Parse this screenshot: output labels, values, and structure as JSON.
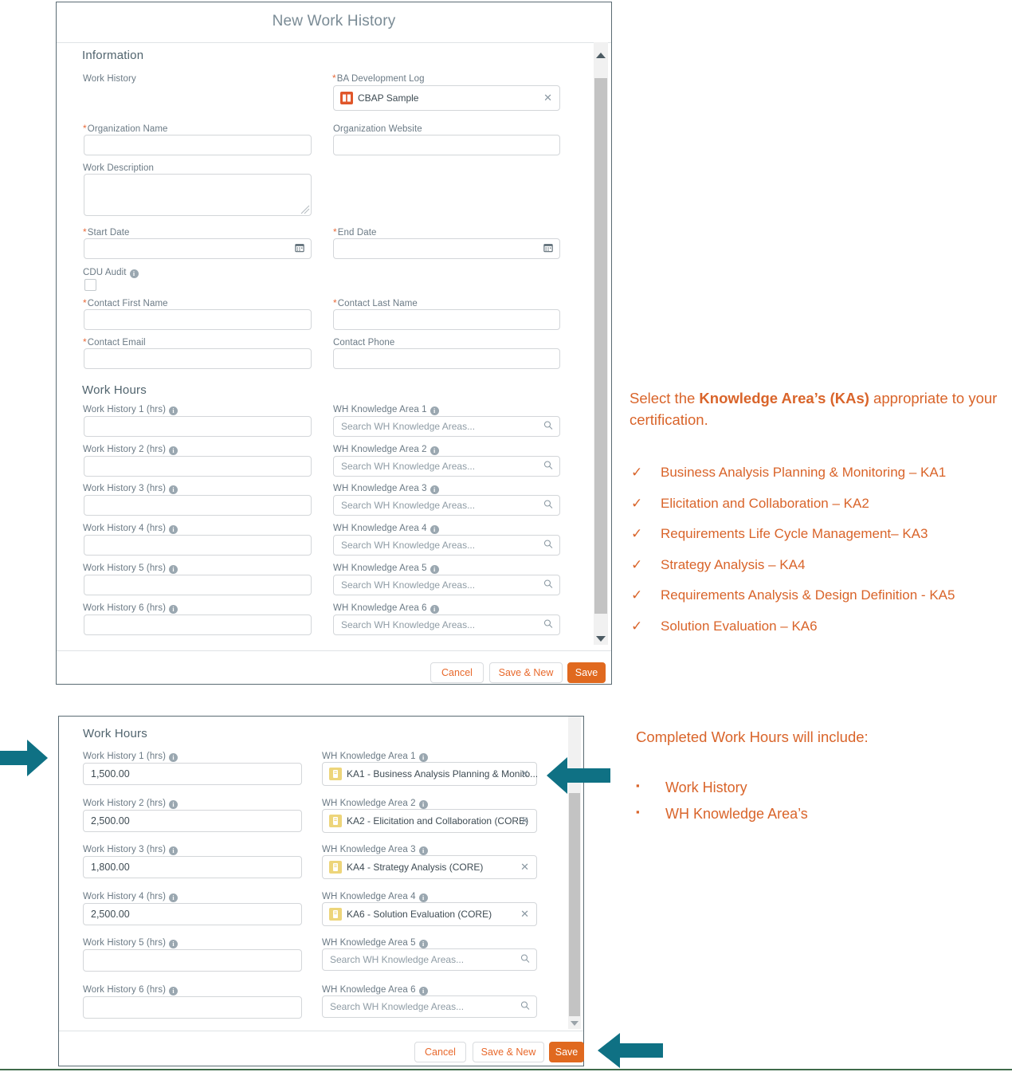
{
  "top_panel": {
    "title": "New Work History",
    "section_information": "Information",
    "section_work_hours": "Work Hours",
    "fields": {
      "work_history_label": "Work History",
      "ba_dev_log_label": "BA Development Log",
      "ba_dev_log_value": "CBAP Sample",
      "org_name_label": "Organization Name",
      "org_website_label": "Organization Website",
      "work_description_label": "Work Description",
      "start_date_label": "Start Date",
      "end_date_label": "End Date",
      "cdu_audit_label": "CDU Audit",
      "contact_first_label": "Contact First Name",
      "contact_last_label": "Contact Last Name",
      "contact_email_label": "Contact Email",
      "contact_phone_label": "Contact Phone"
    },
    "work_hours_rows": [
      {
        "hrs_label": "Work History 1 (hrs)",
        "hrs_value": "",
        "ka_label": "WH Knowledge Area 1",
        "ka_placeholder": "Search WH Knowledge Areas..."
      },
      {
        "hrs_label": "Work History 2 (hrs)",
        "hrs_value": "",
        "ka_label": "WH Knowledge Area 2",
        "ka_placeholder": "Search WH Knowledge Areas..."
      },
      {
        "hrs_label": "Work History 3 (hrs)",
        "hrs_value": "",
        "ka_label": "WH Knowledge Area 3",
        "ka_placeholder": "Search WH Knowledge Areas..."
      },
      {
        "hrs_label": "Work History 4 (hrs)",
        "hrs_value": "",
        "ka_label": "WH Knowledge Area 4",
        "ka_placeholder": "Search WH Knowledge Areas..."
      },
      {
        "hrs_label": "Work History 5 (hrs)",
        "hrs_value": "",
        "ka_label": "WH Knowledge Area 5",
        "ka_placeholder": "Search WH Knowledge Areas..."
      },
      {
        "hrs_label": "Work History 6 (hrs)",
        "hrs_value": "",
        "ka_label": "WH Knowledge Area 6",
        "ka_placeholder": "Search WH Knowledge Areas..."
      }
    ],
    "footer": {
      "cancel": "Cancel",
      "save_new": "Save & New",
      "save": "Save"
    }
  },
  "bottom_panel": {
    "section_work_hours": "Work Hours",
    "rows": [
      {
        "hrs_label": "Work History 1 (hrs)",
        "hrs_value": "1,500.00",
        "ka_label": "WH Knowledge Area 1",
        "ka_value": "KA1 - Business Analysis Planning & Monito...",
        "filled": true
      },
      {
        "hrs_label": "Work History 2 (hrs)",
        "hrs_value": "2,500.00",
        "ka_label": "WH Knowledge Area 2",
        "ka_value": "KA2 - Elicitation and Collaboration (CORE)",
        "filled": true
      },
      {
        "hrs_label": "Work History 3 (hrs)",
        "hrs_value": "1,800.00",
        "ka_label": "WH Knowledge Area 3",
        "ka_value": "KA4 - Strategy Analysis (CORE)",
        "filled": true
      },
      {
        "hrs_label": "Work History 4 (hrs)",
        "hrs_value": "2,500.00",
        "ka_label": "WH Knowledge Area 4",
        "ka_value": "KA6 - Solution Evaluation (CORE)",
        "filled": true
      },
      {
        "hrs_label": "Work History 5 (hrs)",
        "hrs_value": "",
        "ka_label": "WH Knowledge Area 5",
        "ka_value": "Search WH Knowledge Areas...",
        "filled": false
      },
      {
        "hrs_label": "Work History 6 (hrs)",
        "hrs_value": "",
        "ka_label": "WH Knowledge Area 6",
        "ka_value": "Search WH Knowledge Areas...",
        "filled": false
      }
    ],
    "footer": {
      "cancel": "Cancel",
      "save_new": "Save & New",
      "save": "Save"
    }
  },
  "notes": {
    "top_intro_a": "Select the ",
    "top_intro_b": "Knowledge Area’s (KAs)",
    "top_intro_c": " appropriate to your certification.",
    "ka_list": [
      "Business Analysis Planning & Monitoring – KA1",
      "Elicitation and Collaboration – KA2",
      "Requirements Life Cycle Management– KA3",
      "Strategy Analysis – KA4",
      "Requirements Analysis & Design Definition - KA5",
      "Solution Evaluation – KA6"
    ],
    "check_mark": "✓",
    "bullet_mark": "▪",
    "bottom_heading": "Completed Work Hours will include:",
    "bottom_list": [
      "Work History",
      "WH Knowledge Area’s"
    ]
  },
  "colors": {
    "accent_orange": "#d9642a",
    "button_orange": "#e0691f",
    "teal_arrow": "#0f7184",
    "label_grey": "#6b7a85",
    "ka_pill_icon": "#edd57a",
    "log_pill_icon": "#e0562a",
    "bottom_rule_green": "#3f6b4a"
  }
}
